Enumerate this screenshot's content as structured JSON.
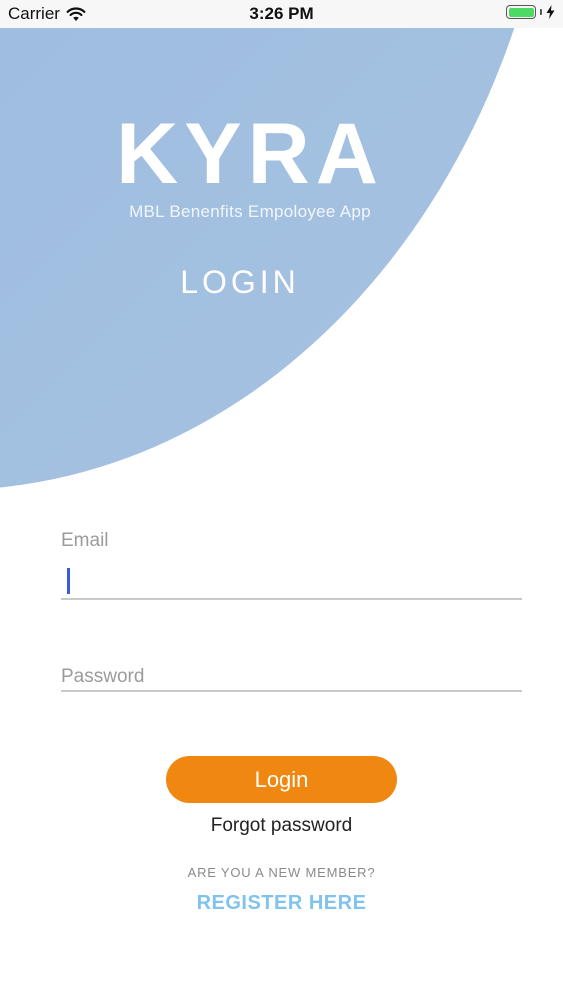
{
  "status_bar": {
    "carrier": "Carrier",
    "time": "3:26 PM",
    "icons": [
      "wifi-icon",
      "battery-icon",
      "charging-bolt-icon"
    ],
    "battery_color": "#4cd964",
    "battery_level": 1.0
  },
  "header": {
    "brand_title": "KYRA",
    "brand_subtitle": "MBL Benenfits Empoloyee App",
    "screen_title": "LOGIN",
    "background_color": "#9cbbde"
  },
  "form": {
    "email_label": "Email",
    "email_value": "",
    "password_label": "Password",
    "password_value": "",
    "cursor_color": "#3b5bdb"
  },
  "actions": {
    "login_label": "Login",
    "login_color": "#ef8710",
    "forgot_label": "Forgot password",
    "new_member_prompt": "ARE YOU A NEW MEMBER?",
    "register_label": "REGISTER HERE",
    "register_color": "#80c3ee"
  }
}
